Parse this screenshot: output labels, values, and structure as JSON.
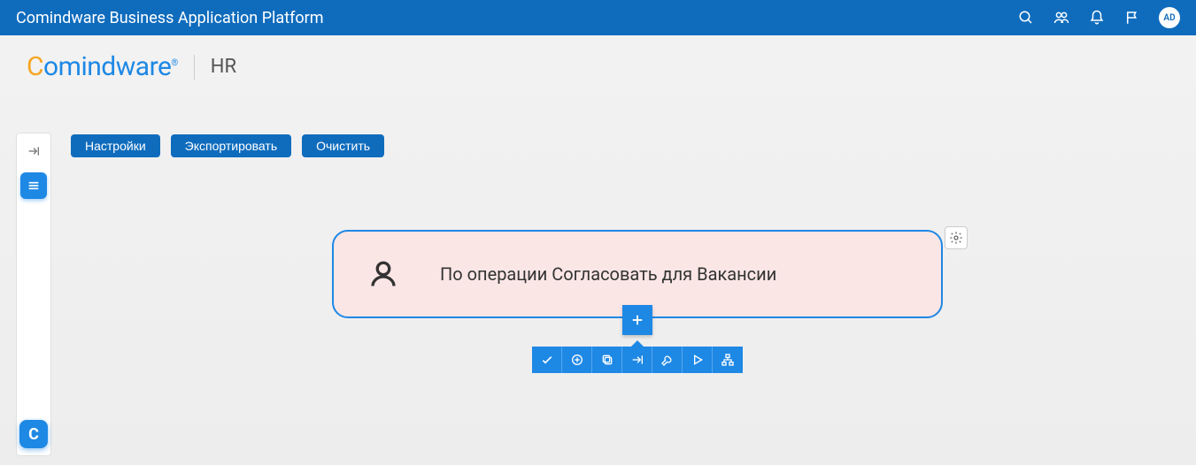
{
  "header": {
    "title": "Comindware Business Application Platform",
    "avatar_initials": "AD"
  },
  "brand": {
    "logo_text": "Comindware",
    "section": "HR"
  },
  "toolbar": {
    "settings": "Настройки",
    "export": "Экспортировать",
    "clear": "Очистить"
  },
  "node": {
    "title": "По операции Согласовать для Вакансии"
  },
  "left_rail": {
    "bottom_badge": "C"
  },
  "icons": {
    "search": "search-icon",
    "users": "users-icon",
    "bell": "bell-icon",
    "flag": "flag-icon",
    "collapse": "collapse-icon",
    "menu": "menu-icon",
    "person": "person-icon",
    "gear": "gear-icon",
    "plus": "plus-icon",
    "check": "check-icon",
    "circle-plus": "circle-plus-icon",
    "copy": "copy-icon",
    "goto": "goto-icon",
    "wrench": "wrench-icon",
    "play": "play-icon",
    "hierarchy": "hierarchy-icon"
  }
}
